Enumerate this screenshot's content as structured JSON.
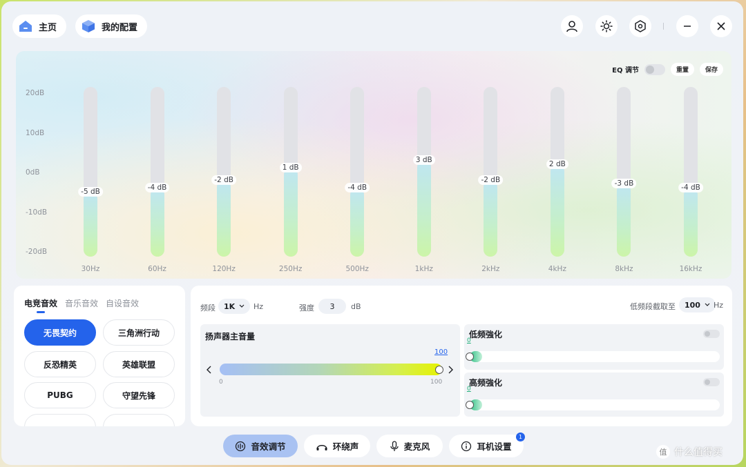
{
  "nav": {
    "home_label": "主页",
    "config_label": "我的配置"
  },
  "eq": {
    "toggle_label": "EQ 调节",
    "reset_label": "重置",
    "save_label": "保存"
  },
  "chart_data": {
    "type": "bar",
    "categories": [
      "30Hz",
      "60Hz",
      "120Hz",
      "250Hz",
      "500Hz",
      "1kHz",
      "2kHz",
      "4kHz",
      "8kHz",
      "16kHz"
    ],
    "values": [
      -5,
      -4,
      -2,
      1,
      -4,
      3,
      -2,
      2,
      -3,
      -4
    ],
    "value_labels": [
      "-5 dB",
      "-4 dB",
      "-2 dB",
      "1 dB",
      "-4 dB",
      "3 dB",
      "-2 dB",
      "2 dB",
      "-3 dB",
      "-4 dB"
    ],
    "y_ticks": [
      "20dB",
      "10dB",
      "0dB",
      "-10dB",
      "-20dB"
    ],
    "ylim": [
      -20,
      20
    ],
    "title": "",
    "xlabel": "",
    "ylabel": ""
  },
  "presets": {
    "tabs": [
      "电竞音效",
      "音乐音效",
      "自设音效"
    ],
    "buttons": [
      "无畏契约",
      "三角洲行动",
      "反恐精英",
      "英雄联盟",
      "PUBG",
      "守望先锋"
    ]
  },
  "controls": {
    "band_label": "频段",
    "band_value": "1K",
    "band_unit": "Hz",
    "gain_label": "强度",
    "gain_value": "3",
    "gain_unit": "dB",
    "lowcut_label": "低频段截取至",
    "lowcut_value": "100",
    "lowcut_unit": "Hz",
    "speaker_title": "扬声器主音量",
    "speaker_value": "100",
    "speaker_min": "0",
    "speaker_max": "100",
    "bass_title": "低频強化",
    "bass_value": "0",
    "treble_title": "高频強化",
    "treble_value": "0"
  },
  "tabs": {
    "sound": "音效调节",
    "surround": "环绕声",
    "mic": "麦克风",
    "headset": "耳机设置",
    "badge": "1"
  },
  "watermark": {
    "text": "什么值得买",
    "logo": "值"
  },
  "colors": {
    "accent": "#2463eb",
    "active_tab": "#a9c2f2"
  }
}
